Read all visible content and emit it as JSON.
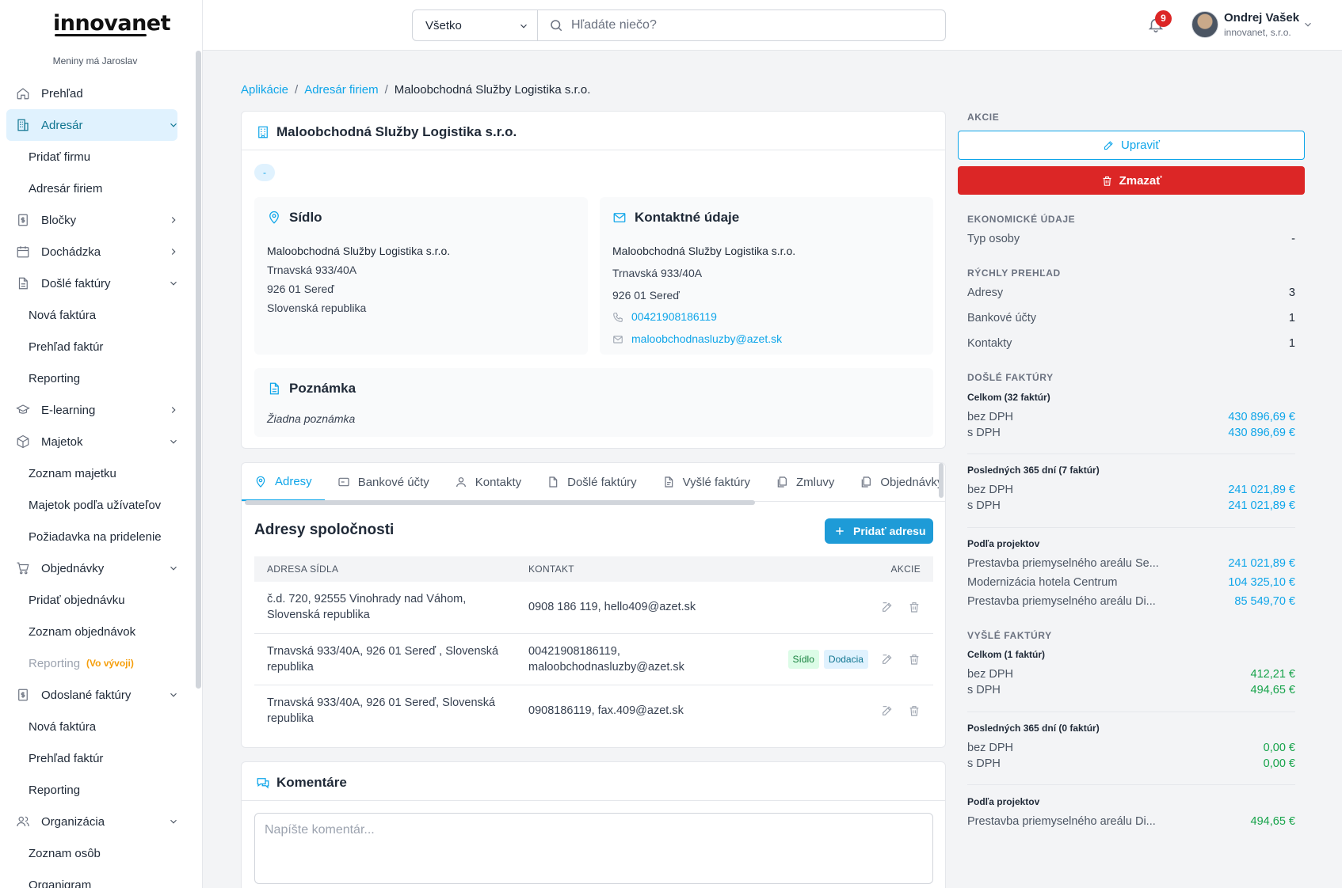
{
  "sidebar": {
    "logo": "innovanet",
    "nameday": "Meniny má Jaroslav",
    "items": [
      {
        "label": "Prehľad"
      },
      {
        "label": "Adresár"
      },
      {
        "label": "Pridať firmu"
      },
      {
        "label": "Adresár firiem"
      },
      {
        "label": "Bločky"
      },
      {
        "label": "Dochádzka"
      },
      {
        "label": "Došlé faktúry"
      },
      {
        "label": "Nová faktúra"
      },
      {
        "label": "Prehľad faktúr"
      },
      {
        "label": "Reporting"
      },
      {
        "label": "E-learning"
      },
      {
        "label": "Majetok"
      },
      {
        "label": "Zoznam majetku"
      },
      {
        "label": "Majetok podľa užívateľov"
      },
      {
        "label": "Požiadavka na pridelenie"
      },
      {
        "label": "Objednávky"
      },
      {
        "label": "Pridať objednávku"
      },
      {
        "label": "Zoznam objednávok"
      },
      {
        "label": "Reporting",
        "badge": "(Vo vývoji)"
      },
      {
        "label": "Odoslané faktúry"
      },
      {
        "label": "Nová faktúra"
      },
      {
        "label": "Prehľad faktúr"
      },
      {
        "label": "Reporting"
      },
      {
        "label": "Organizácia"
      },
      {
        "label": "Zoznam osôb"
      },
      {
        "label": "Organigram"
      }
    ]
  },
  "topbar": {
    "search_scope": "Všetko",
    "search_placeholder": "Hľadáte niečo?",
    "notifications_count": "9",
    "user_name": "Ondrej Vašek",
    "user_org": "innovanet, s.r.o."
  },
  "breadcrumb": {
    "items": [
      "Aplikácie",
      "Adresár firiem"
    ],
    "current": "Maloobchodná Služby Logistika s.r.o."
  },
  "company": {
    "name": "Maloobchodná Služby Logistika s.r.o.",
    "tag": "-",
    "seat": {
      "title": "Sídlo",
      "name": "Maloobchodná Služby Logistika s.r.o.",
      "street": "Trnavská 933/40A",
      "city": "926 01 Sereď",
      "country": "Slovenská republika"
    },
    "contact": {
      "title": "Kontaktné údaje",
      "name": "Maloobchodná Služby Logistika s.r.o.",
      "street": "Trnavská 933/40A",
      "city": "926 01 Sereď",
      "phone": "00421908186119",
      "email": "maloobchodnasluzby@azet.sk"
    },
    "note": {
      "title": "Poznámka",
      "text": "Žiadna poznámka"
    }
  },
  "tabs": {
    "items": [
      "Adresy",
      "Bankové účty",
      "Kontakty",
      "Došlé faktúry",
      "Vyšlé faktúry",
      "Zmluvy",
      "Objednávky"
    ],
    "active": "Adresy"
  },
  "addresses": {
    "title": "Adresy spoločnosti",
    "add_label": "Pridať adresu",
    "columns": [
      "ADRESA SÍDLA",
      "KONTAKT",
      "AKCIE"
    ],
    "rows": [
      {
        "address_1": "č.d. 720, 92555 Vinohrady nad Váhom,",
        "address_2": "Slovenská republika",
        "contact_1": "0908 186 119, hello409@azet.sk",
        "contact_2": "",
        "badge_seat": "",
        "badge_delivery": ""
      },
      {
        "address_1": "Trnavská 933/40A, 926 01 Sereď , Slovenská",
        "address_2": "republika",
        "contact_1": "00421908186119,",
        "contact_2": "maloobchodnasluzby@azet.sk",
        "badge_seat": "Sídlo",
        "badge_delivery": "Dodacia"
      },
      {
        "address_1": "Trnavská 933/40A, 926 01 Sereď, Slovenská",
        "address_2": "republika",
        "contact_1": "0908186119, fax.409@azet.sk",
        "contact_2": "",
        "badge_seat": "",
        "badge_delivery": ""
      }
    ]
  },
  "comments": {
    "title": "Komentáre",
    "placeholder": "Napíšte komentár..."
  },
  "actions": {
    "heading": "AKCIE",
    "edit_label": "Upraviť",
    "delete_label": "Zmazať"
  },
  "economic": {
    "heading": "EKONOMICKÉ ÚDAJE",
    "person_type_label": "Typ osoby",
    "person_type_value": "-"
  },
  "quick": {
    "heading": "RÝCHLY PREHĽAD",
    "rows": [
      {
        "label": "Adresy",
        "value": "3"
      },
      {
        "label": "Bankové účty",
        "value": "1"
      },
      {
        "label": "Kontakty",
        "value": "1"
      }
    ]
  },
  "incoming": {
    "heading": "DOŠLÉ FAKTÚRY",
    "total_title": "Celkom (32 faktúr)",
    "total_net_label": "bez DPH",
    "total_net": "430 896,69 €",
    "total_gross_label": "s DPH",
    "total_gross": "430 896,69 €",
    "recent_title": "Posledných 365 dní (7 faktúr)",
    "recent_net_label": "bez DPH",
    "recent_net": "241 021,89 €",
    "recent_gross_label": "s DPH",
    "recent_gross": "241 021,89 €",
    "projects_title": "Podľa projektov",
    "projects": [
      {
        "label": "Prestavba priemyselného areálu Se...",
        "value": "241 021,89 €"
      },
      {
        "label": "Modernizácia hotela Centrum",
        "value": "104 325,10 €"
      },
      {
        "label": "Prestavba priemyselného areálu Di...",
        "value": "85 549,70 €"
      }
    ]
  },
  "outgoing": {
    "heading": "VYŠLÉ FAKTÚRY",
    "total_title": "Celkom (1 faktúr)",
    "total_net_label": "bez DPH",
    "total_net": "412,21 €",
    "total_gross_label": "s DPH",
    "total_gross": "494,65 €",
    "recent_title": "Posledných 365 dní (0 faktúr)",
    "recent_net_label": "bez DPH",
    "recent_net": "0,00 €",
    "recent_gross_label": "s DPH",
    "recent_gross": "0,00 €",
    "projects_title": "Podľa projektov",
    "projects": [
      {
        "label": "Prestavba priemyselného areálu Di...",
        "value": "494,65 €"
      }
    ]
  },
  "colors": {
    "accent": "#0ea5e9",
    "danger": "#dc2626",
    "success": "#16a34a",
    "active_nav_bg": "#e0f2fe"
  }
}
